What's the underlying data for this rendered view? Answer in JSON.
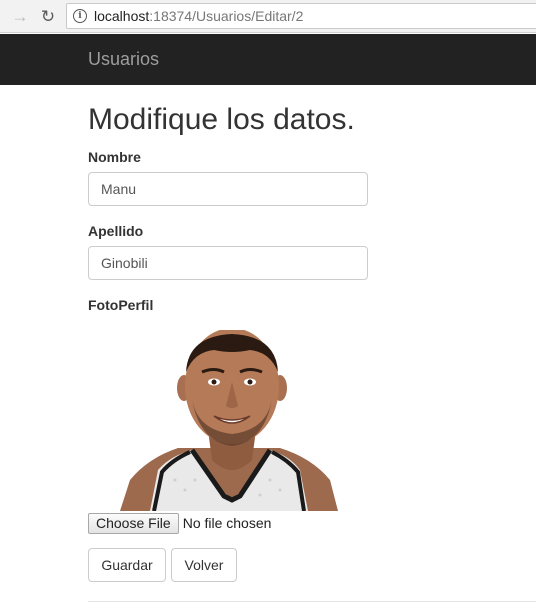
{
  "browser": {
    "url_host": "localhost",
    "url_path": ":18374/Usuarios/Editar/2"
  },
  "navbar": {
    "brand": "Usuarios"
  },
  "form": {
    "title": "Modifique los datos.",
    "nombre_label": "Nombre",
    "nombre_value": "Manu",
    "apellido_label": "Apellido",
    "apellido_value": "Ginobili",
    "foto_label": "FotoPerfil",
    "choose_file_label": "Choose File",
    "no_file_text": "No file chosen",
    "save_label": "Guardar",
    "back_label": "Volver"
  }
}
